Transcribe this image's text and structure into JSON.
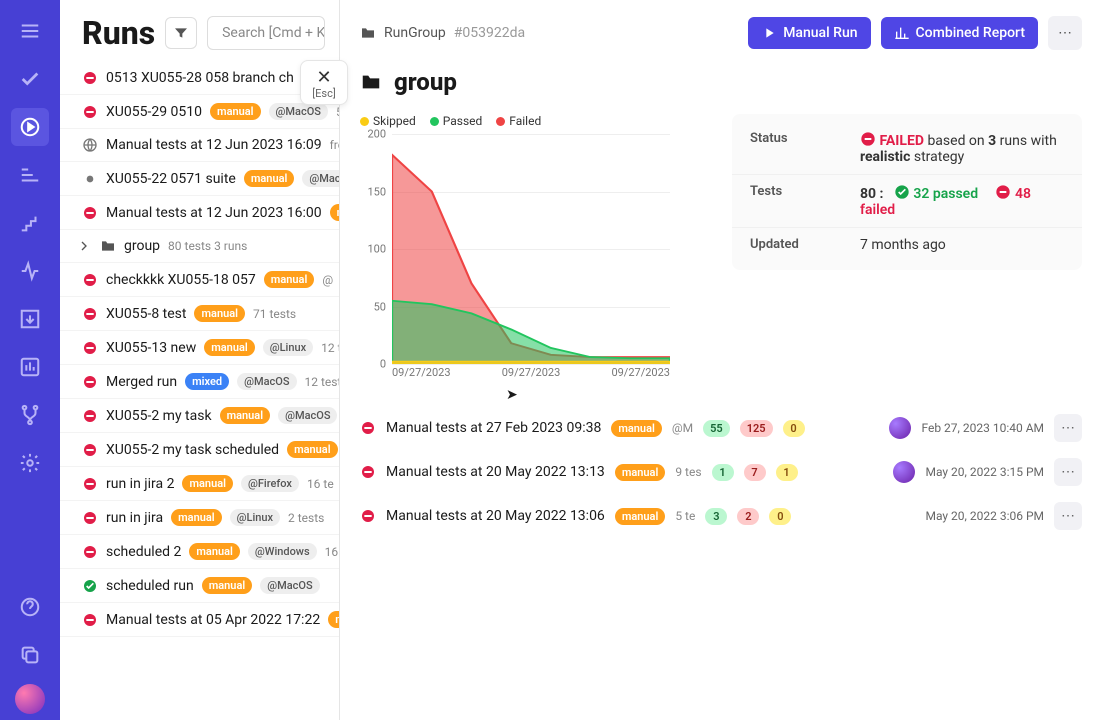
{
  "page_title": "Runs",
  "search_placeholder": "Search [Cmd + K]",
  "close_peek": {
    "label": "[Esc]"
  },
  "breadcrumb": {
    "label": "RunGroup",
    "hash": "#053922da"
  },
  "actions": {
    "manual_run": "Manual Run",
    "combined_report": "Combined Report"
  },
  "group": {
    "title": "group"
  },
  "chart_data": {
    "type": "area",
    "ylim": [
      0,
      200
    ],
    "yticks": [
      0,
      50,
      100,
      150,
      200
    ],
    "categories": [
      "09/27/2023",
      "09/27/2023",
      "09/27/2023"
    ],
    "series": [
      {
        "name": "Failed",
        "color": "#ef4444",
        "values": [
          182,
          150,
          70,
          18,
          8,
          6,
          6,
          6
        ]
      },
      {
        "name": "Passed",
        "color": "#22c55e",
        "values": [
          55,
          52,
          44,
          30,
          14,
          6,
          5,
          5
        ]
      },
      {
        "name": "Skipped",
        "color": "#facc15",
        "values": [
          2,
          2,
          2,
          2,
          2,
          2,
          2,
          2
        ]
      }
    ],
    "legend": {
      "skipped": "Skipped",
      "passed": "Passed",
      "failed": "Failed"
    }
  },
  "info": {
    "status_label": "Status",
    "status_value_prefix": "FAILED",
    "status_value_mid1": "based on",
    "status_runs": "3",
    "status_value_mid2": "runs with",
    "status_strategy": "realistic",
    "status_value_end": "strategy",
    "tests_label": "Tests",
    "tests_total": "80 :",
    "tests_passed": "32",
    "tests_passed_word": "passed",
    "tests_failed": "48",
    "tests_failed_word": "failed",
    "updated_label": "Updated",
    "updated_value": "7 months ago"
  },
  "left_runs": [
    {
      "status": "fail",
      "name": "0513 XU055-28 058 branch ch",
      "badges": [],
      "meta": ""
    },
    {
      "status": "fail",
      "name": "XU055-29 0510",
      "badges": [
        {
          "t": "manual"
        },
        {
          "t": "os",
          "v": "@MacOS"
        }
      ],
      "meta": "5"
    },
    {
      "status": "neutral",
      "name": "Manual tests at 12 Jun 2023 16:09",
      "badges": [],
      "meta": "fron"
    },
    {
      "status": "dot",
      "name": "XU055-22 0571 suite",
      "badges": [
        {
          "t": "manual"
        },
        {
          "t": "os",
          "v": "@Mac"
        }
      ],
      "meta": ""
    },
    {
      "status": "fail",
      "name": "Manual tests at 12 Jun 2023 16:00",
      "badges": [
        {
          "t": "manual"
        }
      ],
      "meta": ""
    },
    {
      "status": "group",
      "name": "group",
      "badges": [],
      "meta": "80 tests  3 runs"
    },
    {
      "status": "fail",
      "name": "checkkkk XU055-18 057",
      "badges": [
        {
          "t": "manual"
        }
      ],
      "meta": "@"
    },
    {
      "status": "fail",
      "name": "XU055-8 test",
      "badges": [
        {
          "t": "manual"
        }
      ],
      "meta": "71 tests"
    },
    {
      "status": "fail",
      "name": "XU055-13 new",
      "badges": [
        {
          "t": "manual"
        },
        {
          "t": "os",
          "v": "@Linux"
        }
      ],
      "meta": "12 t"
    },
    {
      "status": "fail",
      "name": "Merged run",
      "badges": [
        {
          "t": "mixed"
        },
        {
          "t": "os",
          "v": "@MacOS"
        }
      ],
      "meta": "12 test"
    },
    {
      "status": "fail",
      "name": "XU055-2 my task",
      "badges": [
        {
          "t": "manual"
        },
        {
          "t": "os",
          "v": "@MacOS"
        }
      ],
      "meta": ""
    },
    {
      "status": "fail",
      "name": "XU055-2 my task scheduled",
      "badges": [
        {
          "t": "manual"
        }
      ],
      "meta": ""
    },
    {
      "status": "fail",
      "name": "run in jira 2",
      "badges": [
        {
          "t": "manual"
        },
        {
          "t": "os",
          "v": "@Firefox"
        }
      ],
      "meta": "16 te"
    },
    {
      "status": "fail",
      "name": "run in jira",
      "badges": [
        {
          "t": "manual"
        },
        {
          "t": "os",
          "v": "@Linux"
        }
      ],
      "meta": "2 tests"
    },
    {
      "status": "fail",
      "name": "scheduled 2",
      "badges": [
        {
          "t": "manual"
        },
        {
          "t": "os",
          "v": "@Windows"
        }
      ],
      "meta": "16"
    },
    {
      "status": "pass",
      "name": "scheduled run",
      "badges": [
        {
          "t": "manual"
        },
        {
          "t": "os",
          "v": "@MacOS"
        }
      ],
      "meta": ""
    },
    {
      "status": "fail",
      "name": "Manual tests at 05 Apr 2022 17:22",
      "badges": [
        {
          "t": "manual"
        }
      ],
      "meta": ""
    }
  ],
  "group_runs": [
    {
      "status": "fail",
      "name": "Manual tests at 27 Feb 2023 09:38",
      "tag": "manual",
      "os": "@M",
      "pass": "55",
      "fail": "125",
      "skip": "0",
      "avatar": true,
      "date": "Feb 27, 2023 10:40 AM"
    },
    {
      "status": "fail",
      "name": "Manual tests at 20 May 2022 13:13",
      "tag": "manual",
      "os": "9 tes",
      "pass": "1",
      "fail": "7",
      "skip": "1",
      "avatar": true,
      "date": "May 20, 2022 3:15 PM"
    },
    {
      "status": "fail",
      "name": "Manual tests at 20 May 2022 13:06",
      "tag": "manual",
      "os": "5 te",
      "pass": "3",
      "fail": "2",
      "skip": "0",
      "avatar": false,
      "date": "May 20, 2022 3:06 PM"
    }
  ]
}
